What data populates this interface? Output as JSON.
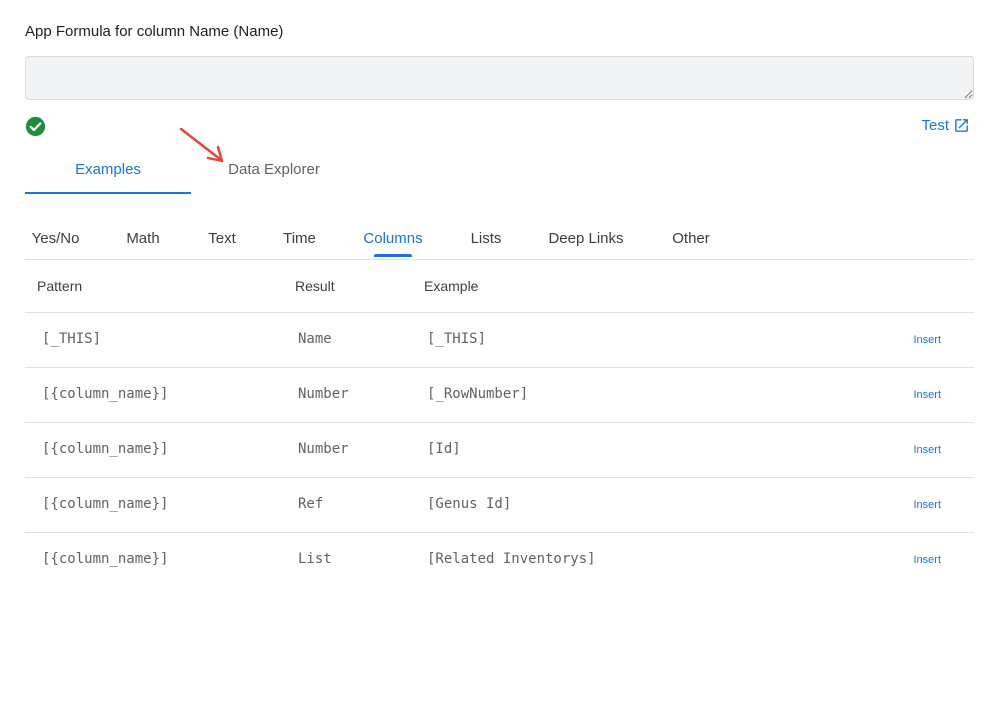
{
  "formula": {
    "label": "App Formula for column Name (Name)",
    "value": ""
  },
  "test_link": {
    "label": "Test"
  },
  "main_tabs": [
    {
      "label": "Examples",
      "active": true
    },
    {
      "label": "Data Explorer",
      "active": false
    }
  ],
  "sub_tabs": [
    {
      "label": "Yes/No"
    },
    {
      "label": "Math"
    },
    {
      "label": "Text"
    },
    {
      "label": "Time"
    },
    {
      "label": "Columns",
      "active": true
    },
    {
      "label": "Lists"
    },
    {
      "label": "Deep Links"
    },
    {
      "label": "Other"
    }
  ],
  "table": {
    "headers": {
      "pattern": "Pattern",
      "result": "Result",
      "example": "Example"
    },
    "insert_label": "Insert",
    "rows": [
      {
        "pattern": "[_THIS]",
        "result": "Name",
        "example": "[_THIS]"
      },
      {
        "pattern": "[{column_name}]",
        "result": "Number",
        "example": "[_RowNumber]"
      },
      {
        "pattern": "[{column_name}]",
        "result": "Number",
        "example": "[Id]"
      },
      {
        "pattern": "[{column_name}]",
        "result": "Ref",
        "example": "[Genus Id]"
      },
      {
        "pattern": "[{column_name}]",
        "result": "List",
        "example": "[Related Inventorys]"
      }
    ]
  },
  "colors": {
    "accent": "#1a73e8",
    "success": "#1e8e3e",
    "annotation_arrow": "#ea4335"
  }
}
